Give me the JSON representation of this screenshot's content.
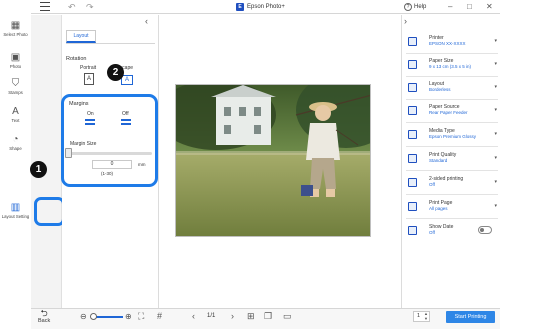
{
  "titlebar": {
    "app_title": "Epson Photo+",
    "logo_glyph": "E",
    "help_label": "Help",
    "undo_icon": "↶",
    "redo_icon": "↷",
    "minimize_icon": "–",
    "maximize_icon": "□",
    "close_icon": "✕"
  },
  "rail": {
    "items": [
      {
        "label": "Select Photo",
        "icon": "photo-select-icon",
        "glyph": "▦"
      },
      {
        "label": "Photo",
        "icon": "photo-add-icon",
        "glyph": "▣"
      },
      {
        "label": "Stamps",
        "icon": "stamp-icon",
        "glyph": "⛉"
      },
      {
        "label": "Text",
        "icon": "text-icon",
        "glyph": "A"
      },
      {
        "label": "Shape",
        "icon": "shape-icon",
        "glyph": "◔"
      },
      {
        "label": "Layout Setting",
        "icon": "layout-setting-icon",
        "glyph": "▥"
      }
    ]
  },
  "panel": {
    "collapse_icon": "‹",
    "tab_label": "Layout",
    "rotation_title": "Rotation",
    "rotation_portrait": "Portrait",
    "rotation_landscape": "ndscape",
    "margins_title": "Margins",
    "margins_on": "On",
    "margins_off": "Off",
    "margin_size_label": "Margin Size",
    "margin_size_value": "0",
    "margin_unit": "mm",
    "margin_range": "(1-30)"
  },
  "callouts": {
    "one": "1",
    "two": "2"
  },
  "print_settings": {
    "collapse_icon": "›",
    "rows": [
      {
        "label": "Printer",
        "value": "EPSON XX-XXXX",
        "icon": "printer-icon"
      },
      {
        "label": "Paper Size",
        "value": "9 x 13 cm (3.5 x 5 in)",
        "icon": "paper-size-icon"
      },
      {
        "label": "Layout",
        "value": "Borderless",
        "icon": "layout-icon"
      },
      {
        "label": "Paper Source",
        "value": "Rear Paper Feeder",
        "icon": "paper-source-icon"
      },
      {
        "label": "Media Type",
        "value": "Epson Premium Glossy",
        "icon": "media-type-icon"
      },
      {
        "label": "Print Quality",
        "value": "Standard",
        "icon": "print-quality-icon"
      },
      {
        "label": "2-sided printing",
        "value": "Off",
        "icon": "two-sided-icon"
      },
      {
        "label": "Print Page",
        "value": "All pages",
        "icon": "print-page-icon"
      },
      {
        "label": "Show Date",
        "value": "Off",
        "icon": "show-date-icon"
      }
    ],
    "dropdown_caret": "▾"
  },
  "bottombar": {
    "back_label": "Back",
    "page_indicator": "1/1",
    "copies": "1",
    "start_label": "Start Printing"
  }
}
